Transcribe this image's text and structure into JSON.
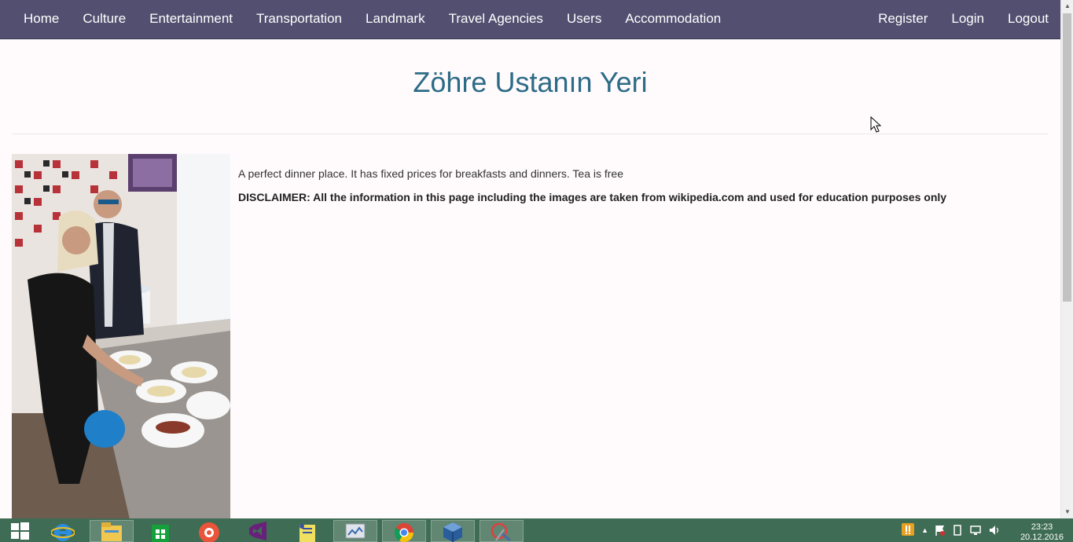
{
  "nav": {
    "left": [
      "Home",
      "Culture",
      "Entertainment",
      "Transportation",
      "Landmark",
      "Travel Agencies",
      "Users",
      "Accommodation"
    ],
    "right": [
      "Register",
      "Login",
      "Logout"
    ]
  },
  "page": {
    "title": "Zöhre Ustanın Yeri",
    "description": "A perfect dinner place. It has fixed prices for breakfasts and dinners. Tea is free",
    "disclaimer": "DISCLAIMER: All the information in this page including the images are taken from wikipedia.com and used for education purposes only"
  },
  "taskbar": {
    "apps": [
      "windows-start-icon",
      "internet-explorer-icon",
      "file-explorer-icon",
      "store-icon",
      "app-icon",
      "visual-studio-icon",
      "notepad-icon",
      "monitor-icon",
      "chrome-icon",
      "virtualbox-icon",
      "snipping-tool-icon"
    ],
    "clock_time": "23:23",
    "clock_date": "20.12.2016"
  },
  "colors": {
    "navbar": "#534f70",
    "title": "#2c6b86",
    "taskbar": "#3f6c54"
  }
}
